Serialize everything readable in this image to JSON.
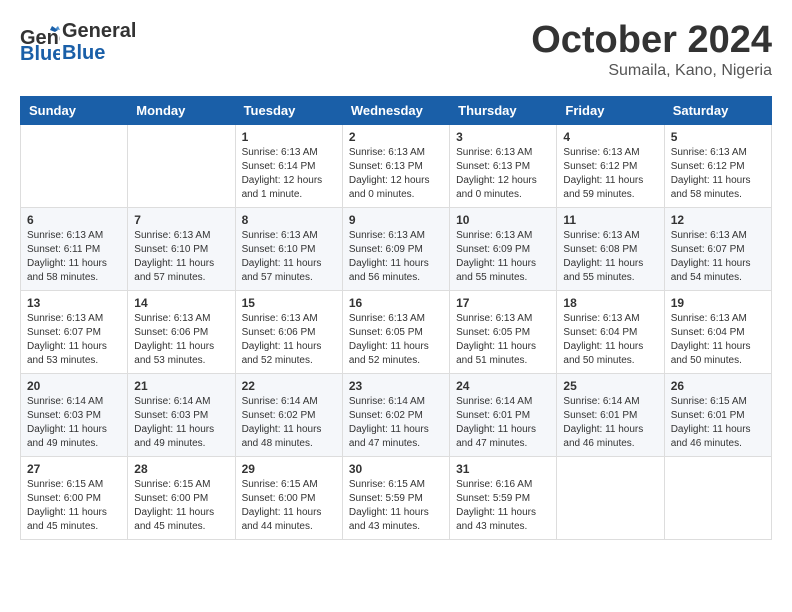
{
  "header": {
    "logo": {
      "line1": "General",
      "line2": "Blue"
    },
    "title": "October 2024",
    "location": "Sumaila, Kano, Nigeria"
  },
  "weekdays": [
    "Sunday",
    "Monday",
    "Tuesday",
    "Wednesday",
    "Thursday",
    "Friday",
    "Saturday"
  ],
  "weeks": [
    [
      {
        "day": "",
        "info": ""
      },
      {
        "day": "",
        "info": ""
      },
      {
        "day": "1",
        "info": "Sunrise: 6:13 AM\nSunset: 6:14 PM\nDaylight: 12 hours\nand 1 minute."
      },
      {
        "day": "2",
        "info": "Sunrise: 6:13 AM\nSunset: 6:13 PM\nDaylight: 12 hours\nand 0 minutes."
      },
      {
        "day": "3",
        "info": "Sunrise: 6:13 AM\nSunset: 6:13 PM\nDaylight: 12 hours\nand 0 minutes."
      },
      {
        "day": "4",
        "info": "Sunrise: 6:13 AM\nSunset: 6:12 PM\nDaylight: 11 hours\nand 59 minutes."
      },
      {
        "day": "5",
        "info": "Sunrise: 6:13 AM\nSunset: 6:12 PM\nDaylight: 11 hours\nand 58 minutes."
      }
    ],
    [
      {
        "day": "6",
        "info": "Sunrise: 6:13 AM\nSunset: 6:11 PM\nDaylight: 11 hours\nand 58 minutes."
      },
      {
        "day": "7",
        "info": "Sunrise: 6:13 AM\nSunset: 6:10 PM\nDaylight: 11 hours\nand 57 minutes."
      },
      {
        "day": "8",
        "info": "Sunrise: 6:13 AM\nSunset: 6:10 PM\nDaylight: 11 hours\nand 57 minutes."
      },
      {
        "day": "9",
        "info": "Sunrise: 6:13 AM\nSunset: 6:09 PM\nDaylight: 11 hours\nand 56 minutes."
      },
      {
        "day": "10",
        "info": "Sunrise: 6:13 AM\nSunset: 6:09 PM\nDaylight: 11 hours\nand 55 minutes."
      },
      {
        "day": "11",
        "info": "Sunrise: 6:13 AM\nSunset: 6:08 PM\nDaylight: 11 hours\nand 55 minutes."
      },
      {
        "day": "12",
        "info": "Sunrise: 6:13 AM\nSunset: 6:07 PM\nDaylight: 11 hours\nand 54 minutes."
      }
    ],
    [
      {
        "day": "13",
        "info": "Sunrise: 6:13 AM\nSunset: 6:07 PM\nDaylight: 11 hours\nand 53 minutes."
      },
      {
        "day": "14",
        "info": "Sunrise: 6:13 AM\nSunset: 6:06 PM\nDaylight: 11 hours\nand 53 minutes."
      },
      {
        "day": "15",
        "info": "Sunrise: 6:13 AM\nSunset: 6:06 PM\nDaylight: 11 hours\nand 52 minutes."
      },
      {
        "day": "16",
        "info": "Sunrise: 6:13 AM\nSunset: 6:05 PM\nDaylight: 11 hours\nand 52 minutes."
      },
      {
        "day": "17",
        "info": "Sunrise: 6:13 AM\nSunset: 6:05 PM\nDaylight: 11 hours\nand 51 minutes."
      },
      {
        "day": "18",
        "info": "Sunrise: 6:13 AM\nSunset: 6:04 PM\nDaylight: 11 hours\nand 50 minutes."
      },
      {
        "day": "19",
        "info": "Sunrise: 6:13 AM\nSunset: 6:04 PM\nDaylight: 11 hours\nand 50 minutes."
      }
    ],
    [
      {
        "day": "20",
        "info": "Sunrise: 6:14 AM\nSunset: 6:03 PM\nDaylight: 11 hours\nand 49 minutes."
      },
      {
        "day": "21",
        "info": "Sunrise: 6:14 AM\nSunset: 6:03 PM\nDaylight: 11 hours\nand 49 minutes."
      },
      {
        "day": "22",
        "info": "Sunrise: 6:14 AM\nSunset: 6:02 PM\nDaylight: 11 hours\nand 48 minutes."
      },
      {
        "day": "23",
        "info": "Sunrise: 6:14 AM\nSunset: 6:02 PM\nDaylight: 11 hours\nand 47 minutes."
      },
      {
        "day": "24",
        "info": "Sunrise: 6:14 AM\nSunset: 6:01 PM\nDaylight: 11 hours\nand 47 minutes."
      },
      {
        "day": "25",
        "info": "Sunrise: 6:14 AM\nSunset: 6:01 PM\nDaylight: 11 hours\nand 46 minutes."
      },
      {
        "day": "26",
        "info": "Sunrise: 6:15 AM\nSunset: 6:01 PM\nDaylight: 11 hours\nand 46 minutes."
      }
    ],
    [
      {
        "day": "27",
        "info": "Sunrise: 6:15 AM\nSunset: 6:00 PM\nDaylight: 11 hours\nand 45 minutes."
      },
      {
        "day": "28",
        "info": "Sunrise: 6:15 AM\nSunset: 6:00 PM\nDaylight: 11 hours\nand 45 minutes."
      },
      {
        "day": "29",
        "info": "Sunrise: 6:15 AM\nSunset: 6:00 PM\nDaylight: 11 hours\nand 44 minutes."
      },
      {
        "day": "30",
        "info": "Sunrise: 6:15 AM\nSunset: 5:59 PM\nDaylight: 11 hours\nand 43 minutes."
      },
      {
        "day": "31",
        "info": "Sunrise: 6:16 AM\nSunset: 5:59 PM\nDaylight: 11 hours\nand 43 minutes."
      },
      {
        "day": "",
        "info": ""
      },
      {
        "day": "",
        "info": ""
      }
    ]
  ]
}
